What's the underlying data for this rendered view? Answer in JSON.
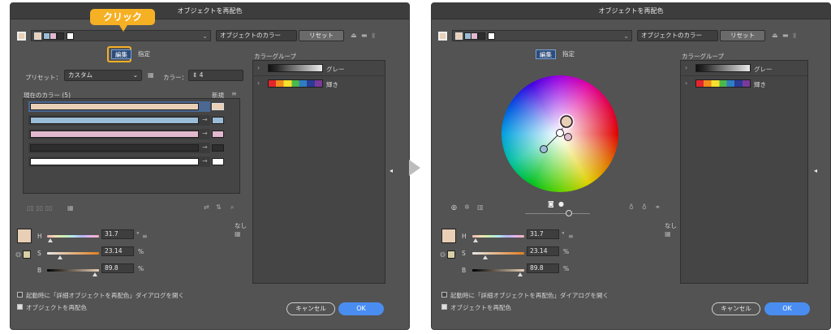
{
  "dialog_title": "オブジェクトを再配色",
  "header": {
    "dropdown_label": "オブジェクトのカラー",
    "reset_label": "リセット"
  },
  "callout_label": "クリック",
  "tabs": [
    "編集",
    "指定"
  ],
  "assign": {
    "preset_label": "プリセット：",
    "preset_value": "カスタム",
    "colors_label": "カラー：",
    "colors_value": "4",
    "current_colors": "現在のカラー (5)",
    "new_label": "新規",
    "none_label": "なし"
  },
  "rows": [
    "#e8cfb6",
    "#9bbcd7",
    "#e2b9cf",
    "#2e2e2e",
    "#ffffff"
  ],
  "color_groups": {
    "title": "カラーグループ",
    "items": [
      {
        "name": "グレー",
        "swatches": [
          "#111111",
          "#2c2c2c",
          "#555555",
          "#7a7a7a",
          "#a0a0a0",
          "#c5c5c5",
          "#ebebeb"
        ]
      },
      {
        "name": "輝き",
        "swatches": [
          "#e3262d",
          "#f08b1e",
          "#f6e12c",
          "#4db84a",
          "#2f7ec2",
          "#2b3b96",
          "#7a3a9a"
        ]
      }
    ]
  },
  "hsb": {
    "h_label": "H",
    "h_value": "31.7",
    "h_unit": "°",
    "s_label": "S",
    "s_value": "23.14",
    "s_unit": "%",
    "b_label": "B",
    "b_value": "89.8",
    "b_unit": "%",
    "swatch": "#e8cfb6"
  },
  "footer": {
    "open_advanced": "起動時に「詳細オブジェクトを再配色」ダイアログを開く",
    "recolor": "オブジェクトを再配色",
    "cancel": "キャンセル",
    "ok": "OK"
  },
  "icons": [
    "chevron-right-icon",
    "arrow-right-icon",
    "delete-icon",
    "folder-icon",
    "save-icon",
    "link-icon",
    "eyedropper-icon"
  ]
}
